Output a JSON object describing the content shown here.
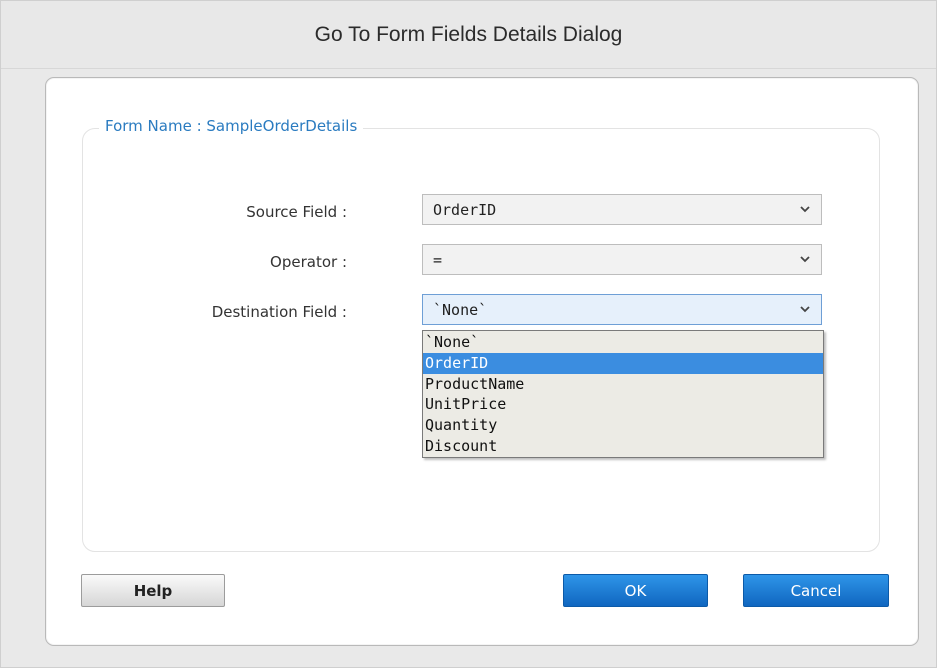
{
  "dialog": {
    "title": "Go To Form Fields Details Dialog"
  },
  "form": {
    "legend": "Form Name : SampleOrderDetails",
    "source_field": {
      "label": "Source Field :",
      "value": "OrderID"
    },
    "operator": {
      "label": "Operator :",
      "value": "="
    },
    "destination_field": {
      "label": "Destination Field :",
      "value": "`None`",
      "options": [
        "`None`",
        "OrderID",
        "ProductName",
        "UnitPrice",
        "Quantity",
        "Discount"
      ],
      "highlighted": "OrderID"
    }
  },
  "buttons": {
    "help": "Help",
    "ok": "OK",
    "cancel": "Cancel"
  },
  "colors": {
    "legend_blue": "#2a7bc0",
    "button_blue": "#1a7cd6",
    "highlight_blue": "#3b8de0"
  },
  "icons": {
    "dropdown": "chevron-down-icon"
  }
}
